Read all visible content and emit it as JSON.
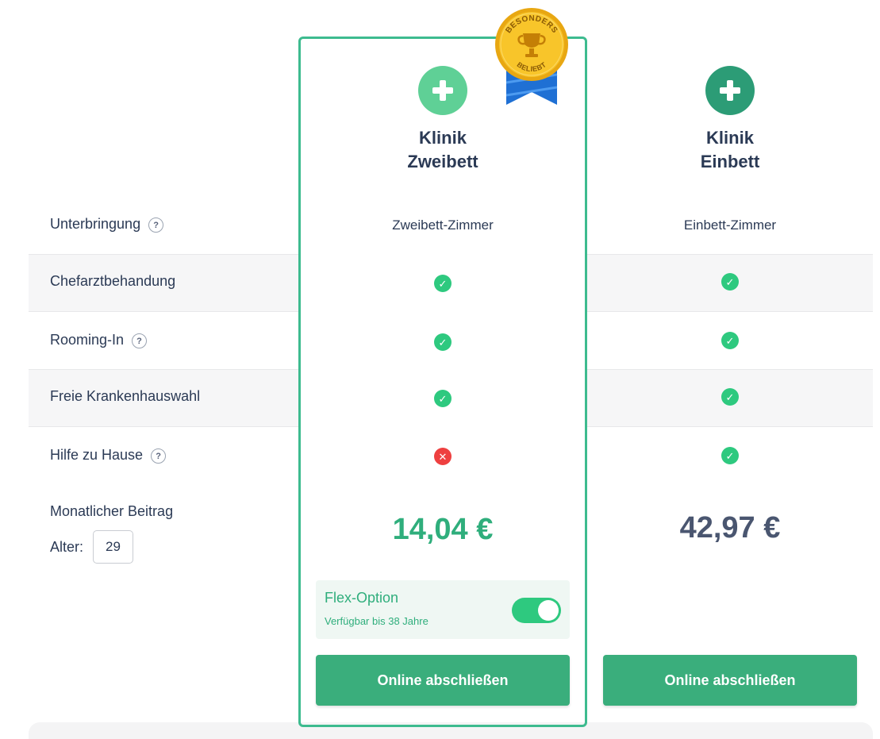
{
  "badge": {
    "top_text": "BESONDERS",
    "bottom_text": "BELIEBT"
  },
  "plans": [
    {
      "title_line1": "Klinik",
      "title_line2": "Zweibett",
      "icon": "medical-cross-icon",
      "icon_color": "#5fd096"
    },
    {
      "title_line1": "Klinik",
      "title_line2": "Einbett",
      "icon": "medical-cross-icon",
      "icon_color": "#2c9c76"
    }
  ],
  "features": [
    {
      "label": "Unterbringung",
      "help": "?",
      "values": [
        "Zweibett-Zimmer",
        "Einbett-Zimmer"
      ]
    },
    {
      "label": "Chefarztbehandung",
      "values": [
        "check",
        "check"
      ]
    },
    {
      "label": "Rooming-In",
      "help": "?",
      "values": [
        "check",
        "check"
      ]
    },
    {
      "label": "Freie Krankenhauswahl",
      "values": [
        "check",
        "check"
      ]
    },
    {
      "label": "Hilfe zu Hause",
      "help": "?",
      "values": [
        "cross",
        "check"
      ]
    }
  ],
  "symbols": {
    "check": "✓",
    "cross": "✕"
  },
  "pricing": {
    "label": "Monatlicher Beitrag",
    "age_label": "Alter:",
    "age_value": "29",
    "prices": [
      "14,04 €",
      "42,97 €"
    ],
    "price_colors": [
      "#2fae7c",
      "#4a5670"
    ]
  },
  "flex_option": {
    "title": "Flex-Option",
    "subtitle": "Verfügbar bis 38 Jahre",
    "enabled": true
  },
  "cta_label": "Online abschließen",
  "colors": {
    "accent": "#3aae7c",
    "highlight_border": "#3dbb8f",
    "check": "#2ec97f",
    "cross": "#ee4040"
  }
}
